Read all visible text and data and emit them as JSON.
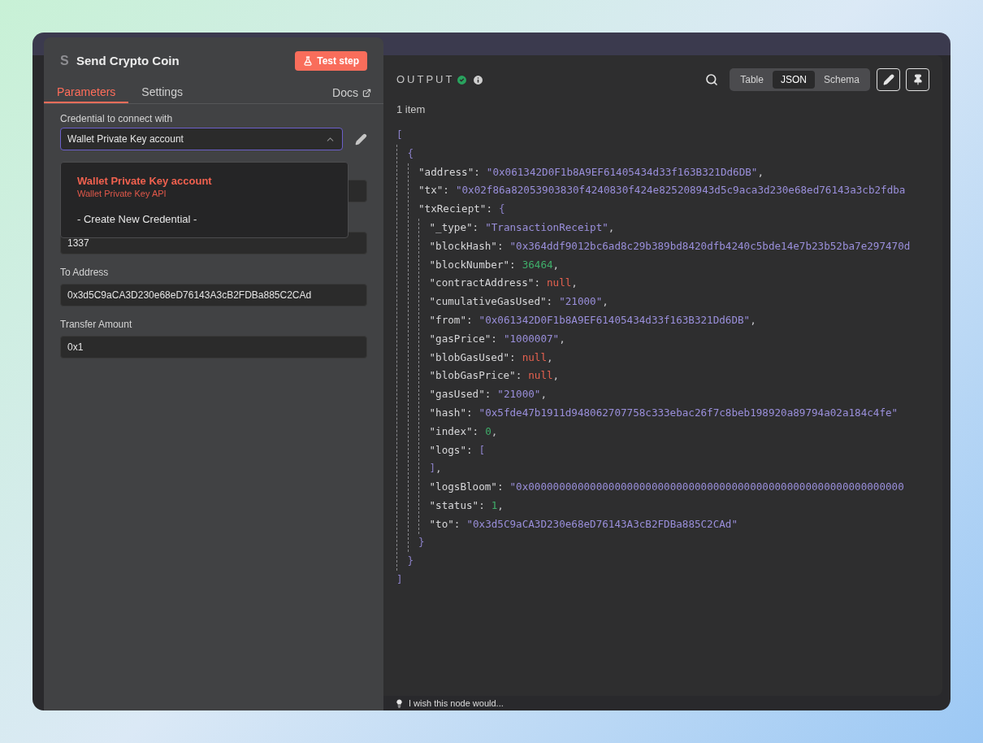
{
  "node": {
    "icon_text": "S",
    "title": "Send Crypto Coin",
    "test_button": "Test step"
  },
  "tabs": [
    {
      "label": "Parameters",
      "selected": true
    },
    {
      "label": "Settings",
      "selected": false
    }
  ],
  "docs_link": "Docs",
  "credential": {
    "label": "Credential to connect with",
    "value": "Wallet Private Key account",
    "expanded": true
  },
  "dropdown": {
    "options": [
      {
        "title": "Wallet Private Key account",
        "subtitle": "Wallet Private Key API",
        "selected": true
      },
      {
        "title": "- Create New Credential -",
        "selected": false
      }
    ]
  },
  "fields": [
    {
      "kind": "input"
    },
    {
      "kind": "input",
      "value": "1337"
    },
    {
      "kind": "input",
      "label": "To Address",
      "value": "0x3d5C9aCA3D230e68eD76143A3cB2FDBa885C2CAd"
    },
    {
      "kind": "input",
      "label": "Transfer Amount",
      "value": "0x1"
    }
  ],
  "output": {
    "title": "OUTPUT",
    "views": [
      {
        "label": "Table",
        "selected": false
      },
      {
        "label": "JSON",
        "selected": true
      },
      {
        "label": "Schema",
        "selected": false
      }
    ],
    "item_count": "1 item",
    "json_tree": {
      "tokens": [
        {
          "kind": "bracket",
          "text": "["
        }
      ],
      "close": [
        {
          "kind": "bracket",
          "text": "]"
        }
      ],
      "children": [
        {
          "tokens": [
            {
              "kind": "bracket",
              "text": "{"
            }
          ],
          "close": [
            {
              "kind": "bracket",
              "text": "}"
            }
          ],
          "children": [
            {
              "tokens": [
                {
                  "kind": "key",
                  "text": "\"address\":"
                },
                {
                  "kind": "string",
                  "text": "\"0x061342D0F1b8A9EF61405434d33f163B321Dd6DB\""
                },
                {
                  "kind": "punct",
                  "text": ","
                }
              ]
            },
            {
              "tokens": [
                {
                  "kind": "key",
                  "text": "\"tx\":"
                },
                {
                  "kind": "string",
                  "text": "\"0x02f86a82053903830f4240830f424e825208943d5c9aca3d230e68ed76143a3cb2fdba"
                }
              ]
            },
            {
              "tokens": [
                {
                  "kind": "key",
                  "text": "\"txReciept\":"
                },
                {
                  "kind": "bracket",
                  "text": "{"
                }
              ],
              "close": [
                {
                  "kind": "bracket",
                  "text": "}"
                }
              ],
              "children": [
                {
                  "tokens": [
                    {
                      "kind": "key",
                      "text": "\"_type\":"
                    },
                    {
                      "kind": "string",
                      "text": "\"TransactionReceipt\""
                    },
                    {
                      "kind": "punct",
                      "text": ","
                    }
                  ]
                },
                {
                  "tokens": [
                    {
                      "kind": "key",
                      "text": "\"blockHash\":"
                    },
                    {
                      "kind": "string",
                      "text": "\"0x364ddf9012bc6ad8c29b389bd8420dfb4240c5bde14e7b23b52ba7e297470d"
                    }
                  ]
                },
                {
                  "tokens": [
                    {
                      "kind": "key",
                      "text": "\"blockNumber\":"
                    },
                    {
                      "kind": "number",
                      "text": "36464"
                    },
                    {
                      "kind": "punct",
                      "text": ","
                    }
                  ]
                },
                {
                  "tokens": [
                    {
                      "kind": "key",
                      "text": "\"contractAddress\":"
                    },
                    {
                      "kind": "null",
                      "text": "null"
                    },
                    {
                      "kind": "punct",
                      "text": ","
                    }
                  ]
                },
                {
                  "tokens": [
                    {
                      "kind": "key",
                      "text": "\"cumulativeGasUsed\":"
                    },
                    {
                      "kind": "string",
                      "text": "\"21000\""
                    },
                    {
                      "kind": "punct",
                      "text": ","
                    }
                  ]
                },
                {
                  "tokens": [
                    {
                      "kind": "key",
                      "text": "\"from\":"
                    },
                    {
                      "kind": "string",
                      "text": "\"0x061342D0F1b8A9EF61405434d33f163B321Dd6DB\""
                    },
                    {
                      "kind": "punct",
                      "text": ","
                    }
                  ]
                },
                {
                  "tokens": [
                    {
                      "kind": "key",
                      "text": "\"gasPrice\":"
                    },
                    {
                      "kind": "string",
                      "text": "\"1000007\""
                    },
                    {
                      "kind": "punct",
                      "text": ","
                    }
                  ]
                },
                {
                  "tokens": [
                    {
                      "kind": "key",
                      "text": "\"blobGasUsed\":"
                    },
                    {
                      "kind": "null",
                      "text": "null"
                    },
                    {
                      "kind": "punct",
                      "text": ","
                    }
                  ]
                },
                {
                  "tokens": [
                    {
                      "kind": "key",
                      "text": "\"blobGasPrice\":"
                    },
                    {
                      "kind": "null",
                      "text": "null"
                    },
                    {
                      "kind": "punct",
                      "text": ","
                    }
                  ]
                },
                {
                  "tokens": [
                    {
                      "kind": "key",
                      "text": "\"gasUsed\":"
                    },
                    {
                      "kind": "string",
                      "text": "\"21000\""
                    },
                    {
                      "kind": "punct",
                      "text": ","
                    }
                  ]
                },
                {
                  "tokens": [
                    {
                      "kind": "key",
                      "text": "\"hash\":"
                    },
                    {
                      "kind": "string",
                      "text": "\"0x5fde47b1911d948062707758c333ebac26f7c8beb198920a89794a02a184c4fe\""
                    }
                  ]
                },
                {
                  "tokens": [
                    {
                      "kind": "key",
                      "text": "\"index\":"
                    },
                    {
                      "kind": "number",
                      "text": "0"
                    },
                    {
                      "kind": "punct",
                      "text": ","
                    }
                  ]
                },
                {
                  "tokens": [
                    {
                      "kind": "key",
                      "text": "\"logs\":"
                    },
                    {
                      "kind": "bracket",
                      "text": "["
                    }
                  ],
                  "close": [
                    {
                      "kind": "bracket",
                      "text": "]"
                    },
                    {
                      "kind": "punct",
                      "text": ","
                    }
                  ]
                },
                {
                  "tokens": [
                    {
                      "kind": "key",
                      "text": "\"logsBloom\":"
                    },
                    {
                      "kind": "string",
                      "text": "\"0x0000000000000000000000000000000000000000000000000000000000000"
                    }
                  ]
                },
                {
                  "tokens": [
                    {
                      "kind": "key",
                      "text": "\"status\":"
                    },
                    {
                      "kind": "number",
                      "text": "1"
                    },
                    {
                      "kind": "punct",
                      "text": ","
                    }
                  ]
                },
                {
                  "tokens": [
                    {
                      "kind": "key",
                      "text": "\"to\":"
                    },
                    {
                      "kind": "string",
                      "text": "\"0x3d5C9aCA3D230e68eD76143A3cB2FDBa885C2CAd\""
                    }
                  ]
                }
              ]
            }
          ]
        }
      ]
    }
  },
  "footer": {
    "text": "I wish this node would..."
  }
}
